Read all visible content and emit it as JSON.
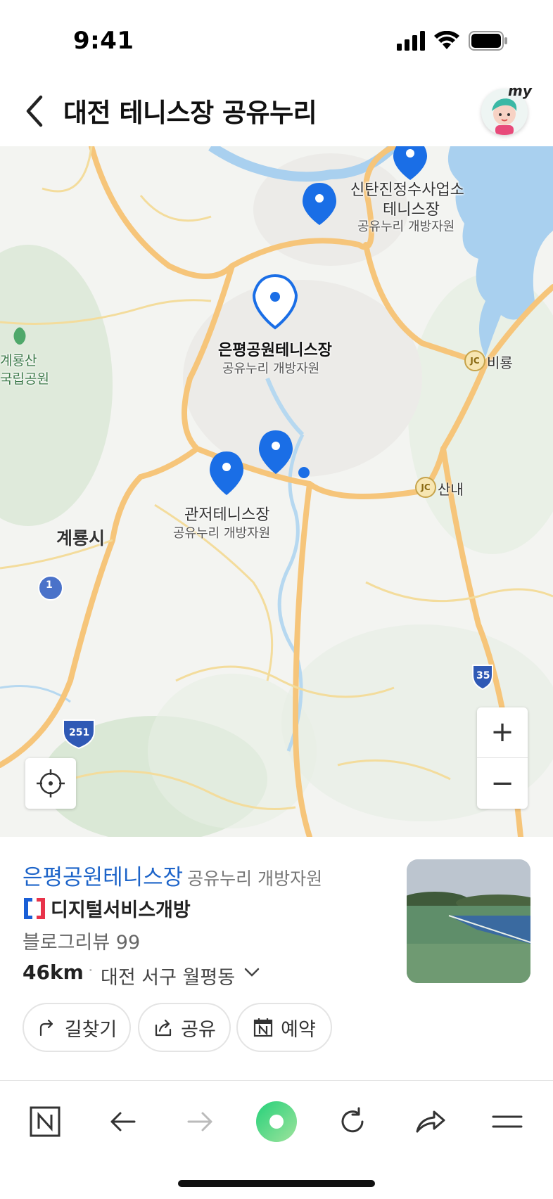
{
  "status_bar": {
    "time": "9:41"
  },
  "header": {
    "title": "대전 테니스장 공유누리",
    "avatar_tag": "my"
  },
  "map": {
    "labels": {
      "sintan_name": "신탄진정수사업소",
      "sintan_name2": "테니스장",
      "sintan_sub": "공유누리 개방자원",
      "eunpyeong_name": "은평공원테니스장",
      "eunpyeong_sub": "공유누리 개방자원",
      "gwanjeo_name": "관저테니스장",
      "gwanjeo_sub": "공유누리 개방자원",
      "city": "계룡시",
      "park1": "계룡산",
      "park2": "국립공원",
      "jc_badge": "JC",
      "jc1": "비룡",
      "jc2": "산내",
      "route_1": "1",
      "route_35": "35",
      "route_251": "251"
    },
    "zoom_in_label": "+",
    "zoom_out_label": "−",
    "pin_color": "#1a6ee6",
    "water_color": "#a9d0ef",
    "road_color": "#f6c57a"
  },
  "place": {
    "name": "은평공원테니스장",
    "category": "공유누리 개방자원",
    "brand": "디지털서비스개방",
    "review": "블로그리뷰 99",
    "distance": "46km",
    "separator": "·",
    "address": "대전 서구 월평동"
  },
  "actions": [
    {
      "label": "길찾기",
      "icon": "directions-icon"
    },
    {
      "label": "공유",
      "icon": "share-icon"
    },
    {
      "label": "예약",
      "icon": "calendar-icon"
    }
  ],
  "toolbar": {
    "items": [
      "naver-home-icon",
      "back-arrow-icon",
      "forward-arrow-icon",
      "green-dot-icon",
      "refresh-icon",
      "share-arrow-icon",
      "menu-icon"
    ]
  }
}
